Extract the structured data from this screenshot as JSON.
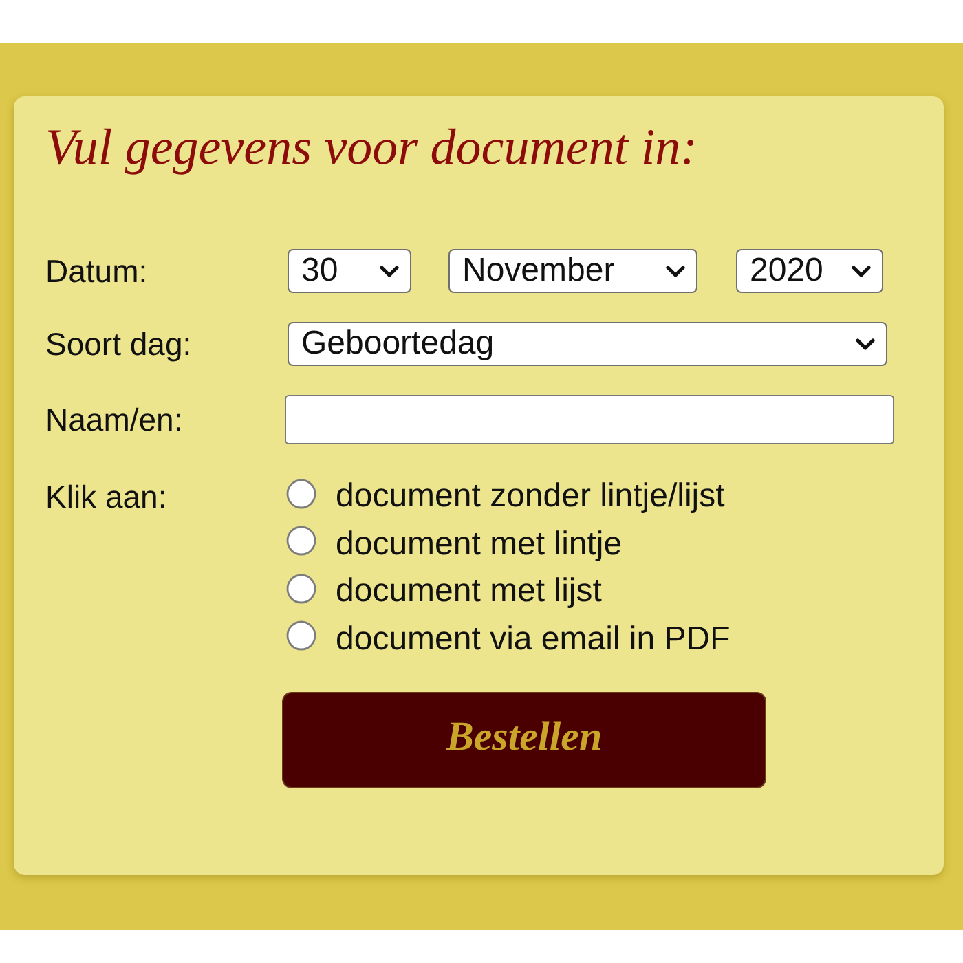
{
  "heading": "Vul gegevens voor document in:",
  "fields": [
    {
      "kind": "date",
      "label": "Datum:",
      "parts": [
        {
          "value": "30"
        },
        {
          "value": "November"
        },
        {
          "value": "2020"
        }
      ]
    },
    {
      "kind": "select",
      "label": "Soort dag:",
      "value": "Geboortedag"
    },
    {
      "kind": "text",
      "label": "Naam/en:"
    }
  ],
  "choice": {
    "label": "Klik aan:",
    "options": [
      {
        "label": "document zonder lintje/lijst",
        "selected": false
      },
      {
        "label": "document met lintje",
        "selected": false
      },
      {
        "label": "document met lijst",
        "selected": false
      },
      {
        "label": "document via email in PDF",
        "selected": false
      }
    ]
  },
  "submit": {
    "label": "Bestellen"
  }
}
